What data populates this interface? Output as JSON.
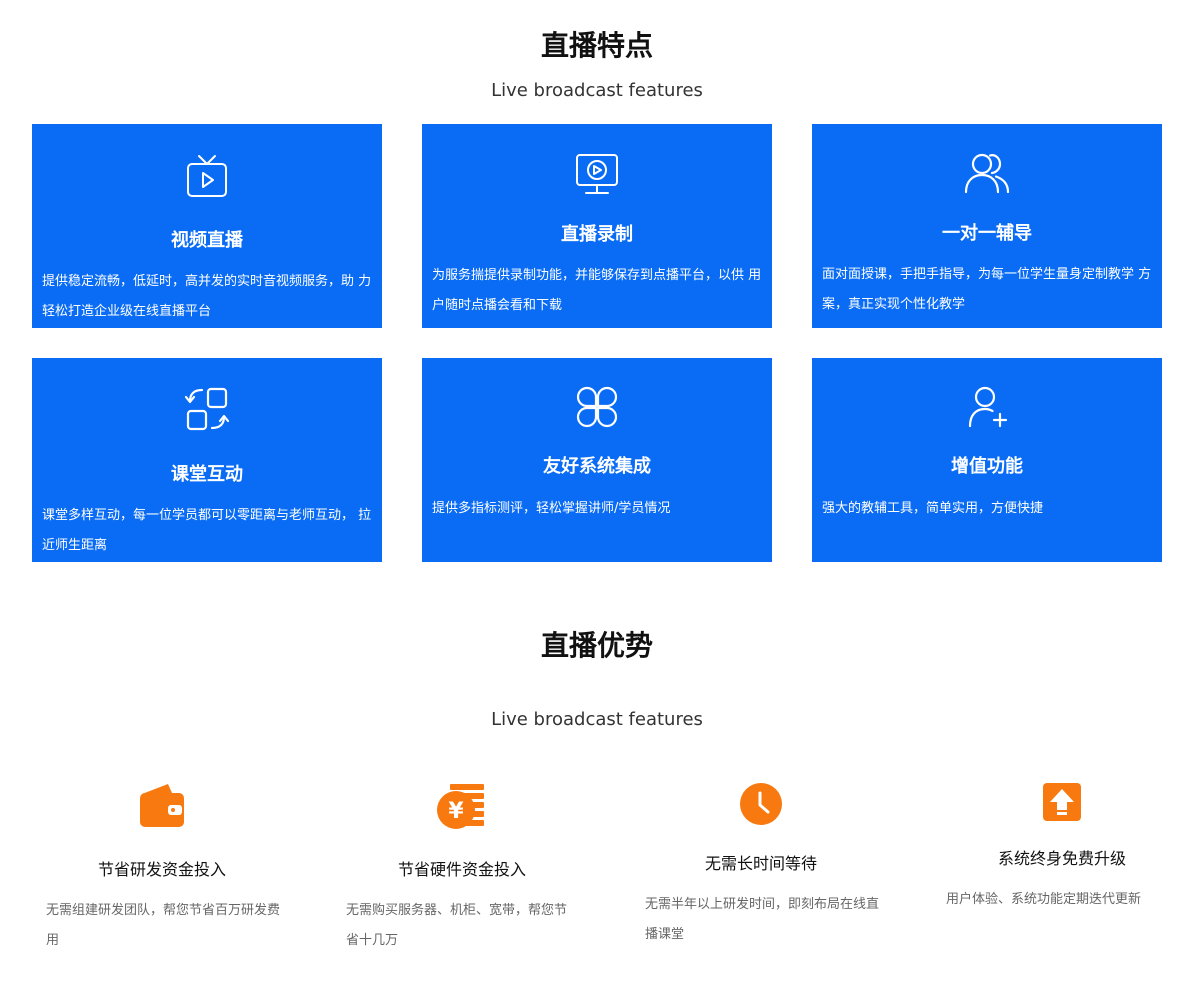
{
  "features": {
    "title": "直播特点",
    "subtitle": "Live broadcast features",
    "cards": [
      {
        "icon": "tv-play-icon",
        "title": "视频直播",
        "desc": "提供稳定流畅，低延时，高并发的实时音视频服务，助 力轻松打造企业级在线直播平台"
      },
      {
        "icon": "monitor-record-icon",
        "title": "直播录制",
        "desc": "为服务揣提供录制功能，并能够保存到点播平台，以供 用户随时点播会看和下载"
      },
      {
        "icon": "users-icon",
        "title": "一对一辅导",
        "desc": "面对面授课，手把手指导，为每一位学生量身定制教学 方案，真正实现个性化教学"
      },
      {
        "icon": "interaction-icon",
        "title": "课堂互动",
        "desc": "课堂多样互动，每一位学员都可以零距离与老师互动， 拉近师生距离"
      },
      {
        "icon": "integration-icon",
        "title": "友好系统集成",
        "desc": "提供多指标测评，轻松掌握讲师/学员情况"
      },
      {
        "icon": "add-user-icon",
        "title": "增值功能",
        "desc": "强大的教辅工具，简单实用，方便快捷"
      }
    ]
  },
  "advantages": {
    "title": "直播优势",
    "subtitle": "Live broadcast features",
    "items": [
      {
        "icon": "wallet-icon",
        "title": "节省研发资金投入",
        "desc": "无需组建研发团队，帮您节省百万研发费用"
      },
      {
        "icon": "yuan-coin-icon",
        "title": "节省硬件资金投入",
        "desc": "无需购买服务器、机柜、宽带，帮您节省十几万"
      },
      {
        "icon": "clock-icon",
        "title": "无需长时间等待",
        "desc": "无需半年以上研发时间，即刻布局在线直播课堂"
      },
      {
        "icon": "upgrade-arrow-icon",
        "title": "系统终身免费升级",
        "desc": "用户体验、系统功能定期迭代更新"
      }
    ]
  },
  "colors": {
    "card_blue": "#0a6cf5",
    "accent_orange": "#f7790f"
  }
}
